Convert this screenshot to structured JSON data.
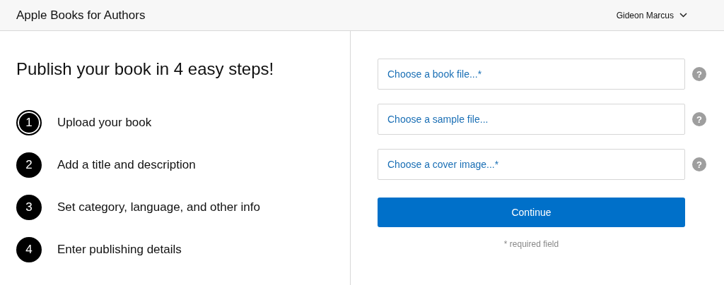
{
  "header": {
    "title": "Apple Books for Authors",
    "user": "Gideon Marcus"
  },
  "heading": "Publish your book in 4 easy steps!",
  "steps": [
    {
      "number": "1",
      "label": "Upload your book",
      "selected": true
    },
    {
      "number": "2",
      "label": "Add a title and description",
      "selected": false
    },
    {
      "number": "3",
      "label": "Set category, language, and other info",
      "selected": false
    },
    {
      "number": "4",
      "label": "Enter publishing details",
      "selected": false
    }
  ],
  "fields": [
    {
      "placeholder": "Choose a book file...*",
      "help": "?"
    },
    {
      "placeholder": "Choose a sample file...",
      "help": "?"
    },
    {
      "placeholder": "Choose a cover image...*",
      "help": "?"
    }
  ],
  "button": "Continue",
  "note": "* required field"
}
